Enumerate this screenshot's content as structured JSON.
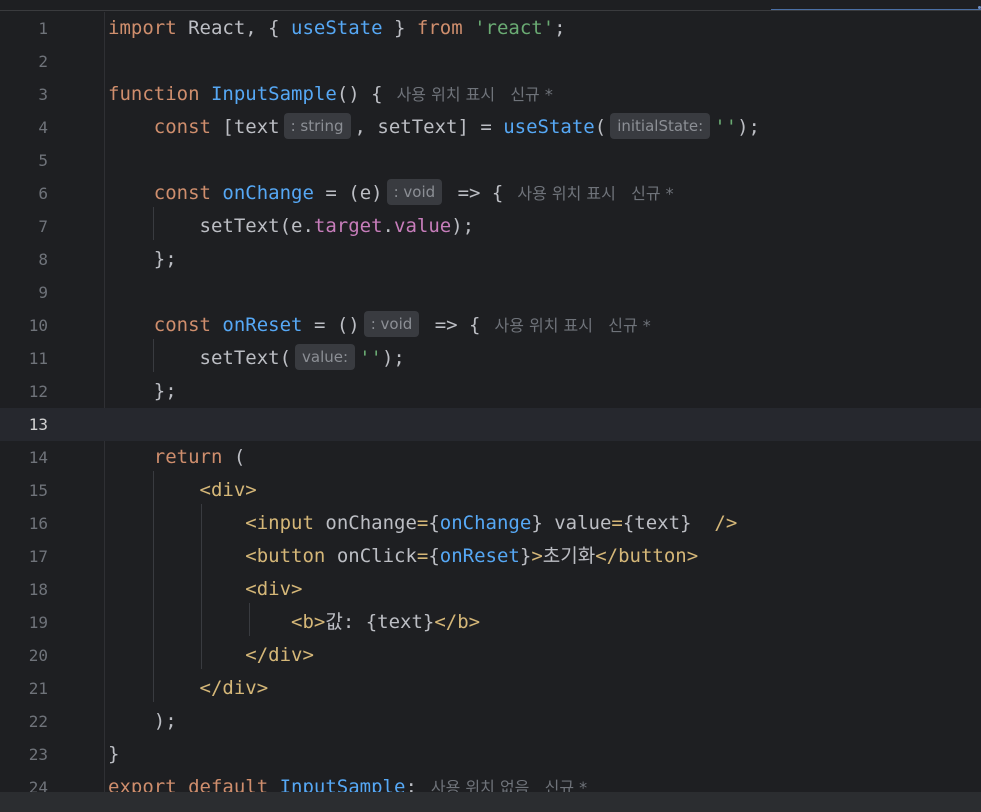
{
  "editor": {
    "language": "javascript-jsx",
    "lines": [
      {
        "n": "1",
        "text": "import React, { useState } from 'react';"
      },
      {
        "n": "2",
        "text": ""
      },
      {
        "n": "3",
        "text": "function InputSample() {",
        "lens": "사용 위치 표시   신규 *"
      },
      {
        "n": "4",
        "text": "const [text",
        "hint_type": ": string",
        "text2": ", setText] = useState(",
        "hint_param": "initialState:",
        "text3": "'');"
      },
      {
        "n": "5",
        "text": ""
      },
      {
        "n": "6",
        "text": "const onChange = (e)",
        "hint_type": ": void",
        "text2": " => {",
        "lens": "사용 위치 표시   신규 *"
      },
      {
        "n": "7",
        "text": "setText(e.target.value);"
      },
      {
        "n": "8",
        "text": "};"
      },
      {
        "n": "9",
        "text": ""
      },
      {
        "n": "10",
        "text": "const onReset = ()",
        "hint_type": ": void",
        "text2": " => {",
        "lens": "사용 위치 표시   신규 *"
      },
      {
        "n": "11",
        "text": "setText(",
        "hint_param": "value:",
        "text2": "'');"
      },
      {
        "n": "12",
        "text": "};"
      },
      {
        "n": "13",
        "text": ""
      },
      {
        "n": "14",
        "text": "return ("
      },
      {
        "n": "15",
        "text": "<div>"
      },
      {
        "n": "16",
        "text": "<input onChange={onChange} value={text}  />"
      },
      {
        "n": "17",
        "text": "<button onClick={onReset}>초기화</button>"
      },
      {
        "n": "18",
        "text": "<div>"
      },
      {
        "n": "19",
        "text": "<b>값: {text}</b>"
      },
      {
        "n": "20",
        "text": "</div>"
      },
      {
        "n": "21",
        "text": "</div>"
      },
      {
        "n": "22",
        "text": ");"
      },
      {
        "n": "23",
        "text": "}"
      },
      {
        "n": "24",
        "text": "export default InputSample;",
        "lens": "사용 위치 없음   신규 *"
      }
    ],
    "current_line": "13"
  },
  "colors": {
    "background": "#1e1f22",
    "keyword": "#cf8e6d",
    "function": "#56a8f5",
    "string": "#6aab73",
    "property": "#c77dbb",
    "tag": "#d5b778",
    "text": "#bcbec4",
    "line_number": "#6f737a"
  }
}
